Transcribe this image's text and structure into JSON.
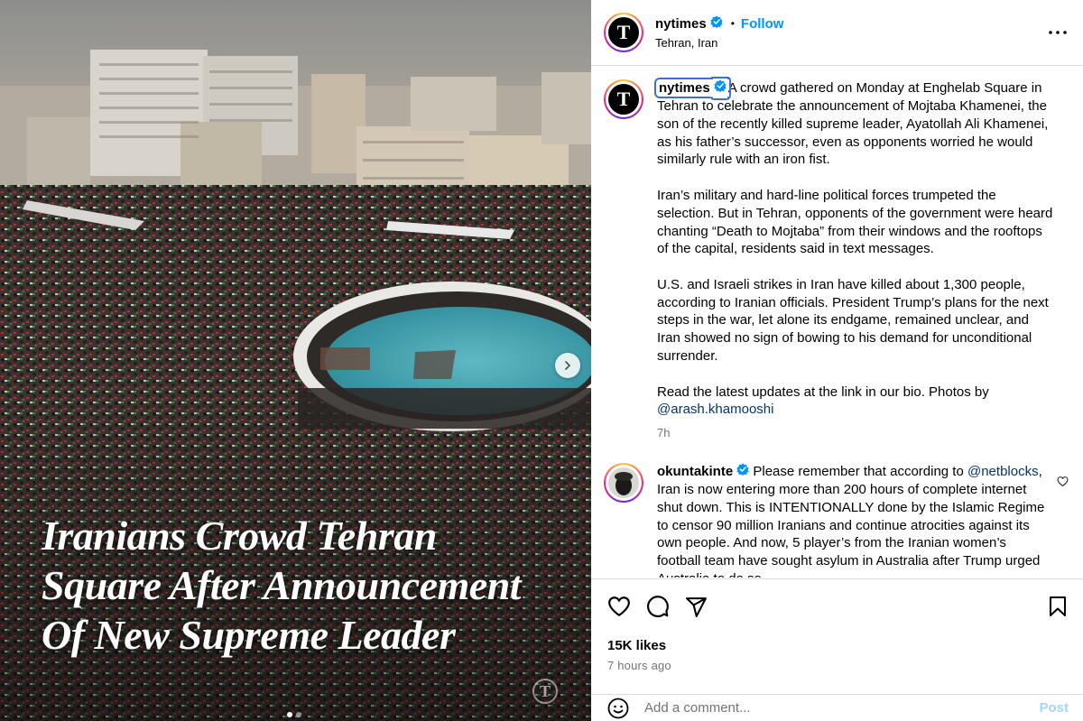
{
  "photo": {
    "headline_lines": [
      "Iranians Crowd Tehran",
      "Square After Announcement",
      "Of New Supreme Leader"
    ],
    "watermark": "T"
  },
  "post": {
    "username": "nytimes",
    "follow_label": "Follow",
    "location": "Tehran, Iran",
    "separator": "•",
    "avatar_letter": "T"
  },
  "caption": {
    "username": "nytimes",
    "paragraphs": [
      "A crowd gathered on Monday at Enghelab Square in Tehran to celebrate the announcement of Mojtaba Khamenei, the son of the recently killed supreme leader, Ayatollah Ali Khamenei, as his father’s successor, even as opponents worried he would similarly rule with an iron fist.",
      "Iran’s military and hard-line political forces trumpeted the selection. But in Tehran, opponents of the government were heard chanting “Death to Mojtaba” from their windows and the rooftops of the capital, residents said in text messages.",
      "U.S. and Israeli strikes in Iran have killed about 1,300 people, according to Iranian officials. President Trump’s plans for the next steps in the war, let alone its endgame, remained unclear, and Iran showed no sign of bowing to his demand for unconditional surrender."
    ],
    "last_paragraph_text": "Read the latest updates at the link in our bio. Photos by",
    "mention": "@arash.khamooshi",
    "time": "7h"
  },
  "comment": {
    "username": "okuntakinte",
    "text_before_mention": "Please remember that according to",
    "mention": "@netblocks",
    "text_after_mention": ", Iran is now entering more than 200 hours of complete internet shut down. This is INTENTIONALLY done by the Islamic Regime to censor 90 million Iranians and continue atrocities against its own people. And now, 5 player’s from the Iranian women’s football team have sought asylum in Australia after Trump urged Australia to do so."
  },
  "actions": {
    "likes": "15K likes",
    "time_ago": "7 hours ago"
  },
  "add_comment": {
    "placeholder": "Add a comment...",
    "post_label": "Post"
  },
  "colors": {
    "accent": "#0095f6",
    "verified": "#0095f6",
    "link": "#00376b",
    "muted": "#737373",
    "border": "#dbdbdb"
  }
}
